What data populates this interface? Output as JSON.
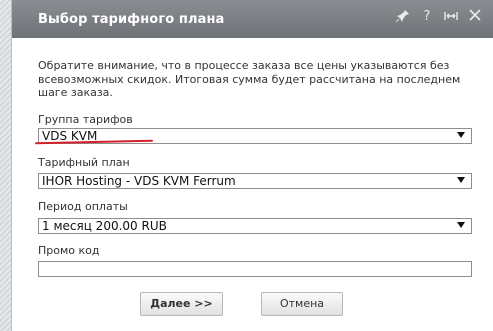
{
  "dialog": {
    "title": "Выбор тарифного плана",
    "icons": [
      "pin-icon",
      "help-icon",
      "resize-icon",
      "close-icon"
    ],
    "notice": "Обратите внимание, что в процессе заказа все цены указываются без всевозможных скидок. Итоговая сумма будет рассчитана на последнем шаге заказа.",
    "fields": {
      "group": {
        "label": "Группа тарифов",
        "value": "VDS KVM"
      },
      "plan": {
        "label": "Тарифный план",
        "value": "IHOR Hosting - VDS KVM Ferrum"
      },
      "period": {
        "label": "Период оплаты",
        "value": "1 месяц 200.00 RUB"
      },
      "promo": {
        "label": "Промо код",
        "value": ""
      }
    },
    "buttons": {
      "next": "Далее >>",
      "cancel": "Отмена"
    },
    "colors": {
      "titlebar": "#7c7f84",
      "annotation_underline": "#d4202a"
    }
  }
}
